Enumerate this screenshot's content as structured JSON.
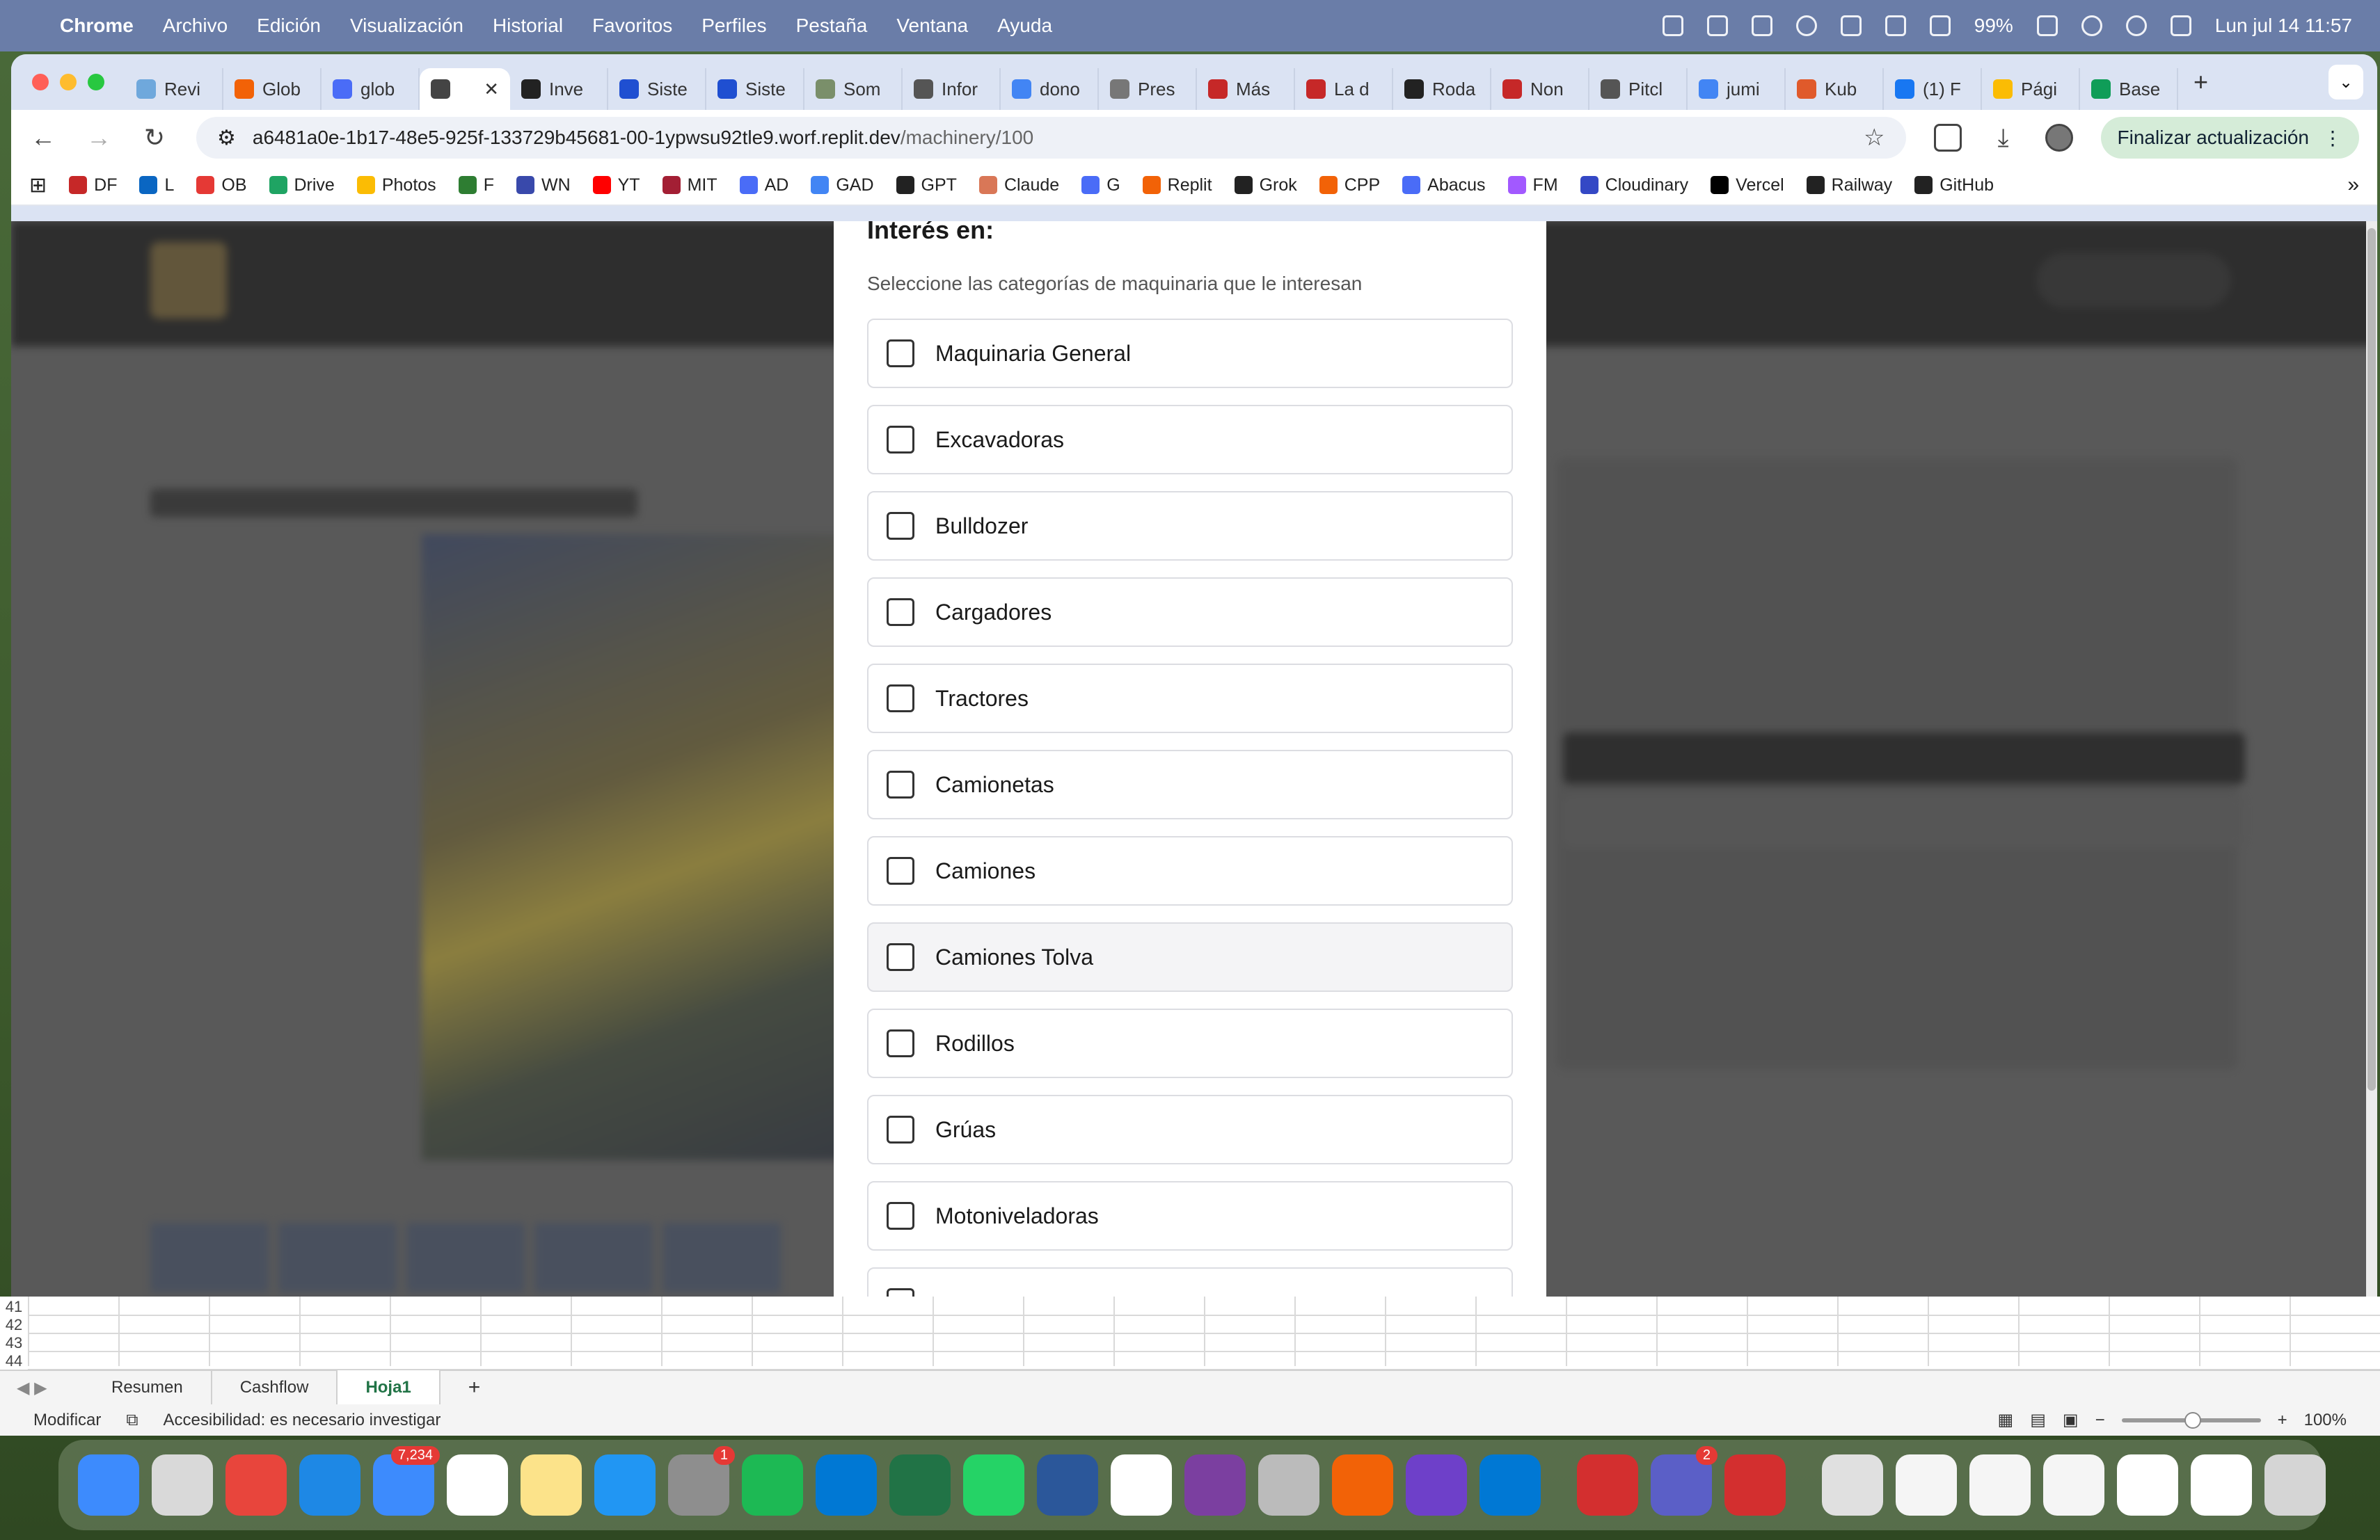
{
  "menubar": {
    "app_name": "Chrome",
    "menus": [
      "Archivo",
      "Edición",
      "Visualización",
      "Historial",
      "Favoritos",
      "Perfiles",
      "Pestaña",
      "Ventana",
      "Ayuda"
    ],
    "battery": "99%",
    "datetime": "Lun jul 14  11:57"
  },
  "browser": {
    "tabs": [
      {
        "label": "Revi",
        "color": "#6fa8dc"
      },
      {
        "label": "Glob",
        "color": "#f26207"
      },
      {
        "label": "glob",
        "color": "#4a6cf7"
      },
      {
        "label": "",
        "color": "#444444",
        "active": true
      },
      {
        "label": "Inve",
        "color": "#222222"
      },
      {
        "label": "Siste",
        "color": "#1f4fd1"
      },
      {
        "label": "Siste",
        "color": "#1f4fd1"
      },
      {
        "label": "Som",
        "color": "#7a8f6a"
      },
      {
        "label": "Infor",
        "color": "#555555"
      },
      {
        "label": "dono",
        "color": "#4285f4"
      },
      {
        "label": "Pres",
        "color": "#777777"
      },
      {
        "label": "Más",
        "color": "#c62828"
      },
      {
        "label": "La d",
        "color": "#c62828"
      },
      {
        "label": "Roda",
        "color": "#222222"
      },
      {
        "label": "Non",
        "color": "#c62828"
      },
      {
        "label": "Pitcl",
        "color": "#555555"
      },
      {
        "label": "jumi",
        "color": "#4285f4"
      },
      {
        "label": "Kub",
        "color": "#e05a2b"
      },
      {
        "label": "(1) F",
        "color": "#1877f2"
      },
      {
        "label": "Pági",
        "color": "#fbbc04"
      },
      {
        "label": "Base",
        "color": "#0f9d58"
      }
    ],
    "url_host": "a6481a0e-1b17-48e5-925f-133729b45681-00-1ypwsu92tle9.worf.replit.dev",
    "url_path": "/machinery/100",
    "update_label": "Finalizar actualización",
    "bookmarks": [
      {
        "label": "DF",
        "color": "#c62828"
      },
      {
        "label": "L",
        "color": "#0a66c2"
      },
      {
        "label": "OB",
        "color": "#e53935"
      },
      {
        "label": "Drive",
        "color": "#1fa463"
      },
      {
        "label": "Photos",
        "color": "#fbbc04"
      },
      {
        "label": "F",
        "color": "#2e7d32"
      },
      {
        "label": "WN",
        "color": "#3949ab"
      },
      {
        "label": "YT",
        "color": "#ff0000"
      },
      {
        "label": "MIT",
        "color": "#a31f34"
      },
      {
        "label": "AD",
        "color": "#4a6cf7"
      },
      {
        "label": "GAD",
        "color": "#4285f4"
      },
      {
        "label": "GPT",
        "color": "#222222"
      },
      {
        "label": "Claude",
        "color": "#d97757"
      },
      {
        "label": "G",
        "color": "#4a6cf7"
      },
      {
        "label": "Replit",
        "color": "#f26207"
      },
      {
        "label": "Grok",
        "color": "#222222"
      },
      {
        "label": "CPP",
        "color": "#f26207"
      },
      {
        "label": "Abacus",
        "color": "#4a6cf7"
      },
      {
        "label": "FM",
        "color": "#a259ff"
      },
      {
        "label": "Cloudinary",
        "color": "#3448c5"
      },
      {
        "label": "Vercel",
        "color": "#000000"
      },
      {
        "label": "Railway",
        "color": "#222222"
      },
      {
        "label": "GitHub",
        "color": "#222222"
      }
    ]
  },
  "modal": {
    "title": "Interés en:",
    "subtitle": "Seleccione las categorías de maquinaria que le interesan",
    "categories": [
      {
        "label": "Maquinaria General",
        "checked": false
      },
      {
        "label": "Excavadoras",
        "checked": false
      },
      {
        "label": "Bulldozer",
        "checked": false
      },
      {
        "label": "Cargadores",
        "checked": false
      },
      {
        "label": "Tractores",
        "checked": false
      },
      {
        "label": "Camionetas",
        "checked": false
      },
      {
        "label": "Camiones",
        "checked": false
      },
      {
        "label": "Camiones Tolva",
        "checked": false,
        "hover": true
      },
      {
        "label": "Rodillos",
        "checked": false
      },
      {
        "label": "Grúas",
        "checked": false
      },
      {
        "label": "Motoniveladoras",
        "checked": false
      },
      {
        "label": "",
        "checked": false
      }
    ]
  },
  "excel": {
    "rows": [
      "41",
      "42",
      "43",
      "44"
    ],
    "sheets": [
      {
        "label": "Resumen",
        "active": false
      },
      {
        "label": "Cashflow",
        "active": false
      },
      {
        "label": "Hoja1",
        "active": true
      }
    ],
    "status_mode": "Modificar",
    "accessibility": "Accesibilidad: es necesario investigar",
    "zoom": "100%"
  },
  "dock": {
    "apps": [
      {
        "name": "finder-icon",
        "color": "#3d8bfd"
      },
      {
        "name": "launchpad-icon",
        "color": "#d9d9d9"
      },
      {
        "name": "chrome-icon",
        "color": "#e8453c"
      },
      {
        "name": "safari-icon",
        "color": "#1e88e5"
      },
      {
        "name": "mail-icon",
        "color": "#3d8bfd",
        "badge": "7,234"
      },
      {
        "name": "calendar-icon",
        "color": "#ffffff"
      },
      {
        "name": "notes-icon",
        "color": "#fce38a"
      },
      {
        "name": "keynote-icon",
        "color": "#2196f3"
      },
      {
        "name": "system-settings-icon",
        "color": "#8e8e8e",
        "badge": "1"
      },
      {
        "name": "spotify-icon",
        "color": "#1db954"
      },
      {
        "name": "outlook-icon",
        "color": "#0078d4"
      },
      {
        "name": "excel-icon",
        "color": "#217346"
      },
      {
        "name": "whatsapp-icon",
        "color": "#25d366"
      },
      {
        "name": "word-icon",
        "color": "#2b579a"
      },
      {
        "name": "fantastical-icon",
        "color": "#ffffff"
      },
      {
        "name": "record-icon",
        "color": "#7b3fa0"
      },
      {
        "name": "iphone-mirroring-icon",
        "color": "#bbbbbb"
      },
      {
        "name": "replit-icon",
        "color": "#f26207"
      },
      {
        "name": "github-desktop-icon",
        "color": "#6e40c9"
      },
      {
        "name": "vscode-icon",
        "color": "#0078d4"
      },
      {
        "name": "acrobat-icon",
        "color": "#d32f2f"
      },
      {
        "name": "teams-icon",
        "color": "#5b5fc7",
        "badge": "2"
      },
      {
        "name": "zoom-icon",
        "color": "#d32f2f"
      },
      {
        "name": "documents-folder-icon",
        "color": "#e0e0e0"
      },
      {
        "name": "file-stack-icon",
        "color": "#f5f5f5"
      },
      {
        "name": "screenshot-icon",
        "color": "#f5f5f5"
      },
      {
        "name": "terminal-window-icon",
        "color": "#f5f5f5"
      },
      {
        "name": "blank-window-icon",
        "color": "#ffffff"
      },
      {
        "name": "blank-window-2-icon",
        "color": "#ffffff"
      },
      {
        "name": "trash-icon",
        "color": "#d5d5d5"
      }
    ]
  }
}
